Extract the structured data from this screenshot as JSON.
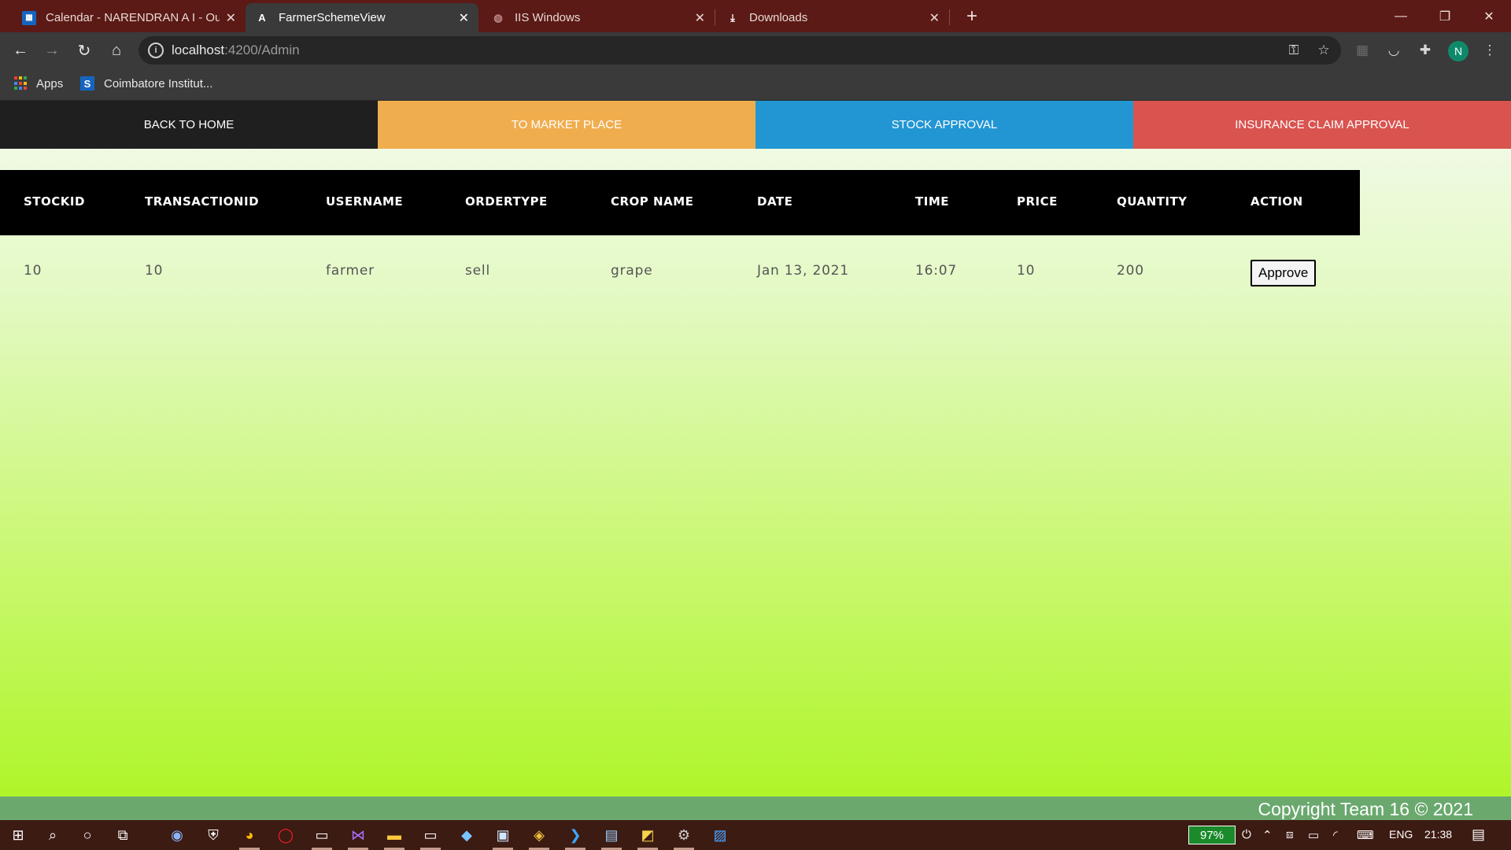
{
  "browser": {
    "tabs": [
      {
        "title": "Calendar - NARENDRAN A I - Ou",
        "icon": "outlook-calendar-icon"
      },
      {
        "title": "FarmerSchemeView",
        "icon": "angular-icon",
        "active": true
      },
      {
        "title": "IIS Windows",
        "icon": "globe-icon"
      },
      {
        "title": "Downloads",
        "icon": "download-icon"
      }
    ],
    "url_host": "localhost",
    "url_rest": ":4200/Admin",
    "profile_initial": "N",
    "bookmarks": [
      {
        "label": "Apps",
        "icon": "apps-grid-icon"
      },
      {
        "label": "Coimbatore Institut...",
        "icon": "site-s-icon"
      }
    ]
  },
  "nav": {
    "home": "BACK TO HOME",
    "market": "TO MARKET PLACE",
    "stock": "STOCK APPROVAL",
    "insurance": "INSURANCE CLAIM APPROVAL",
    "colors": {
      "home": "#1f1f1f",
      "market": "#f0ad4e",
      "stock": "#2196d3",
      "insurance": "#d9534f"
    }
  },
  "table": {
    "headers": [
      "STOCKID",
      "TRANSACTIONID",
      "USERNAME",
      "ORDERTYPE",
      "CROP NAME",
      "DATE",
      "TIME",
      "PRICE",
      "QUANTITY",
      "ACTION"
    ],
    "rows": [
      {
        "stockid": "10",
        "transactionid": "10",
        "username": "farmer",
        "ordertype": "sell",
        "crop": "grape",
        "date": "Jan 13, 2021",
        "time": "16:07",
        "price": "10",
        "quantity": "200",
        "action": "Approve"
      }
    ]
  },
  "footer": "Copyright Team 16 © 2021",
  "taskbar": {
    "battery": "97%",
    "language": "ENG",
    "clock": "21:38"
  }
}
